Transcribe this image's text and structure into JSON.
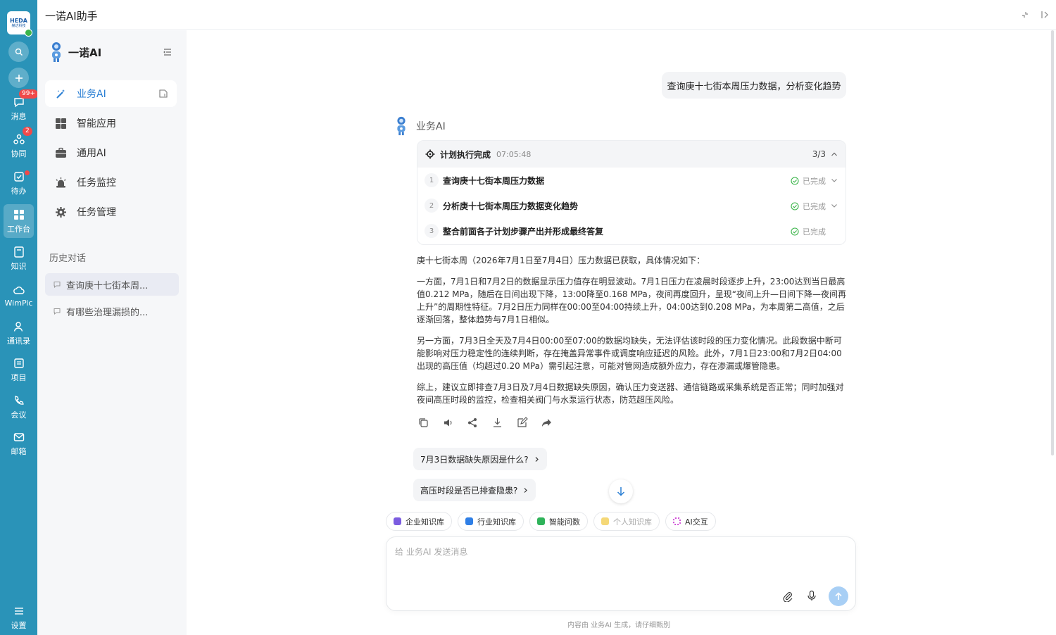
{
  "rail": {
    "logo_line1": "HEDA",
    "logo_line2": "赫达科技",
    "messages": {
      "label": "消息",
      "badge": "99+"
    },
    "collab": {
      "label": "协同",
      "badge": "2"
    },
    "todo": {
      "label": "待办"
    },
    "workbench": {
      "label": "工作台"
    },
    "knowledge": {
      "label": "知识"
    },
    "wimpic": {
      "label": "WimPic"
    },
    "contacts": {
      "label": "通讯录"
    },
    "project": {
      "label": "项目"
    },
    "meeting": {
      "label": "会议"
    },
    "mail": {
      "label": "邮箱"
    },
    "settings": {
      "label": "设置"
    }
  },
  "window": {
    "title": "一诺AI助手"
  },
  "sidebar": {
    "brand": "一诺AI",
    "nav": [
      {
        "label": "业务AI"
      },
      {
        "label": "智能应用"
      },
      {
        "label": "通用AI"
      },
      {
        "label": "任务监控"
      },
      {
        "label": "任务管理"
      }
    ],
    "history_title": "历史对话",
    "history": [
      {
        "label": "查询庚十七街本周..."
      },
      {
        "label": "有哪些治理漏损的..."
      }
    ]
  },
  "chat": {
    "user_message": "查询庚十七街本周压力数据，分析变化趋势",
    "bot_name": "业务AI",
    "plan": {
      "title": "计划执行完成",
      "time": "07:05:48",
      "count": "3/3",
      "steps": [
        {
          "num": "1",
          "title": "查询庚十七街本周压力数据",
          "status": "已完成"
        },
        {
          "num": "2",
          "title": "分析庚十七街本周压力数据变化趋势",
          "status": "已完成"
        },
        {
          "num": "3",
          "title": "整合前面各子计划步骤产出并形成最终答复",
          "status": "已完成"
        }
      ]
    },
    "answer": [
      "庚十七街本周（2026年7月1日至7月4日）压力数据已获取，具体情况如下：",
      "一方面，7月1日和7月2日的数据显示压力值存在明显波动。7月1日压力在凌晨时段逐步上升，23:00达到当日最高值0.212 MPa，随后在日间出现下降，13:00降至0.168 MPa，夜间再度回升，呈现“夜间上升—日间下降—夜间再上升”的周期性特征。7月2日压力同样在00:00至04:00持续上升，04:00达到0.208 MPa，为本周第二高值，之后逐渐回落，整体趋势与7月1日相似。",
      "另一方面，7月3日全天及7月4日00:00至07:00的数据均缺失，无法评估该时段的压力变化情况。此段数据中断可能影响对压力稳定性的连续判断，存在掩盖异常事件或调度响应延迟的风险。此外，7月1日23:00和7月2日04:00出现的高压值（均超过0.20 MPa）需引起注意，可能对管网造成额外应力，存在渗漏或爆管隐患。",
      "综上，建议立即排查7月3日及7月4日数据缺失原因，确认压力变送器、通信链路或采集系统是否正常；同时加强对夜间高压时段的监控，检查相关阀门与水泵运行状态，防范超压风险。"
    ],
    "suggestions": [
      "7月3日数据缺失原因是什么?",
      "高压时段是否已排查隐患?"
    ],
    "chips": [
      {
        "label": "企业知识库",
        "color": "#7b5ce0"
      },
      {
        "label": "行业知识库",
        "color": "#2f7fe6"
      },
      {
        "label": "智能问数",
        "color": "#2fb35a"
      },
      {
        "label": "个人知识库",
        "color": "#f5c542"
      },
      {
        "label": "AI交互",
        "color": "#d04fd8"
      }
    ],
    "input_placeholder": "给 业务AI 发送消息",
    "disclaimer": "内容由 业务AI 生成，请仔细甄别"
  },
  "colors": {
    "rail": "#2a93b8",
    "accent": "#2a7fd4",
    "success": "#3bb54a",
    "badge": "#f04a4a"
  }
}
